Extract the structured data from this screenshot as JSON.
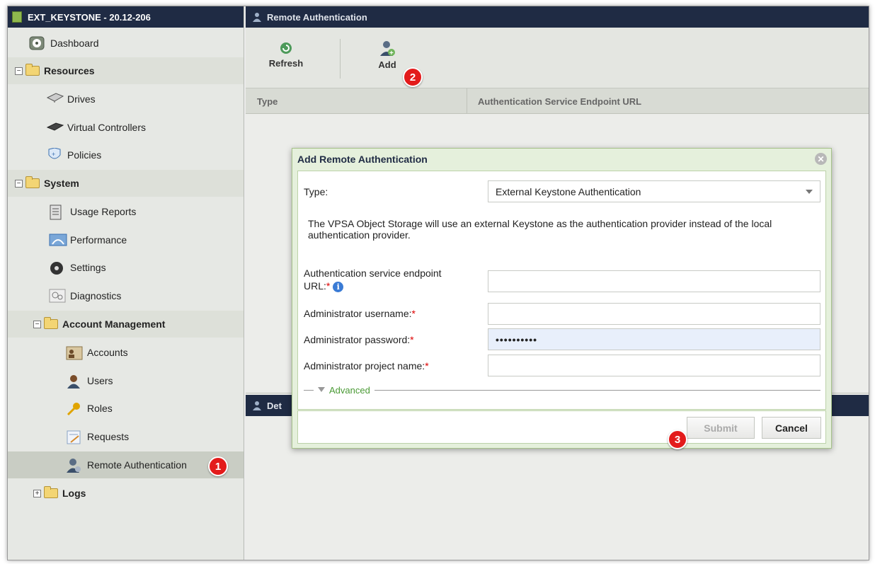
{
  "sidebar": {
    "title": "EXT_KEYSTONE - 20.12-206",
    "items": [
      {
        "label": "Dashboard"
      },
      {
        "label": "Resources"
      },
      {
        "label": "Drives"
      },
      {
        "label": "Virtual Controllers"
      },
      {
        "label": "Policies"
      },
      {
        "label": "System"
      },
      {
        "label": "Usage Reports"
      },
      {
        "label": "Performance"
      },
      {
        "label": "Settings"
      },
      {
        "label": "Diagnostics"
      },
      {
        "label": "Account Management"
      },
      {
        "label": "Accounts"
      },
      {
        "label": "Users"
      },
      {
        "label": "Roles"
      },
      {
        "label": "Requests"
      },
      {
        "label": "Remote Authentication"
      },
      {
        "label": "Logs"
      }
    ],
    "selected": "Remote Authentication"
  },
  "main": {
    "title": "Remote Authentication",
    "toolbar": {
      "refresh_label": "Refresh",
      "add_label": "Add"
    },
    "columns": [
      "Type",
      "Authentication Service Endpoint URL"
    ],
    "details_title": "Det"
  },
  "badges": [
    "1",
    "2",
    "3"
  ],
  "dialog": {
    "title": "Add Remote Authentication",
    "type_label": "Type:",
    "type_value": "External Keystone Authentication",
    "description": "The VPSA Object Storage will use an external Keystone as the authentication provider instead of the local authentication provider.",
    "fields": {
      "endpoint_label_1": "Authentication service endpoint",
      "endpoint_label_2": "URL:",
      "username_label": "Administrator username:",
      "password_label": "Administrator password:",
      "password_value": "••••••••••",
      "project_label": "Administrator project name:",
      "required_mark": "*",
      "info_glyph": "i"
    },
    "advanced_label": "Advanced",
    "submit_label": "Submit",
    "cancel_label": "Cancel"
  },
  "colors": {
    "header_navy": "#1f2b44",
    "dialog_green": "#e5f0dc",
    "badge_red": "#e31b1b",
    "advanced_green": "#4a9a35"
  }
}
